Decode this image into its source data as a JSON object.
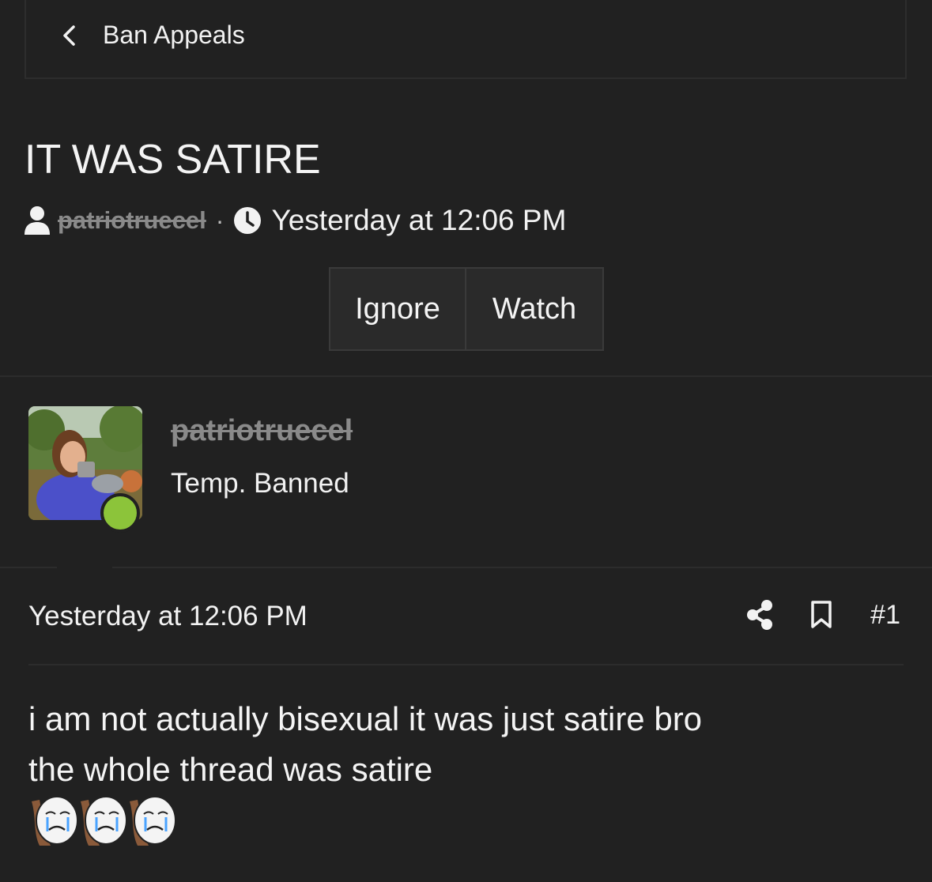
{
  "breadcrumb": {
    "label": "Ban Appeals"
  },
  "thread": {
    "title": "IT WAS SATIRE",
    "author": "patriotruecel",
    "separator": "·",
    "date": "Yesterday at 12:06 PM"
  },
  "actions": {
    "ignore_label": "Ignore",
    "watch_label": "Watch"
  },
  "post": {
    "poster_name": "patriotruecel",
    "poster_title": "Temp. Banned",
    "online_color": "#8cc43a",
    "date": "Yesterday at 12:06 PM",
    "number": "#1",
    "body_lines": [
      "i am not actually bisexual it was just satire bro",
      "the whole thread was satire"
    ],
    "emojis": [
      "crying-face-emoji",
      "crying-face-emoji",
      "crying-face-emoji"
    ]
  },
  "icons": {
    "back": "chevron-left-icon",
    "user": "user-icon",
    "clock": "clock-icon",
    "share": "share-icon",
    "bookmark": "bookmark-icon"
  },
  "colors": {
    "background": "#212121",
    "strikethrough_name": "#8a8a8a",
    "button_bg": "#2a2a2a",
    "online": "#8cc43a"
  }
}
